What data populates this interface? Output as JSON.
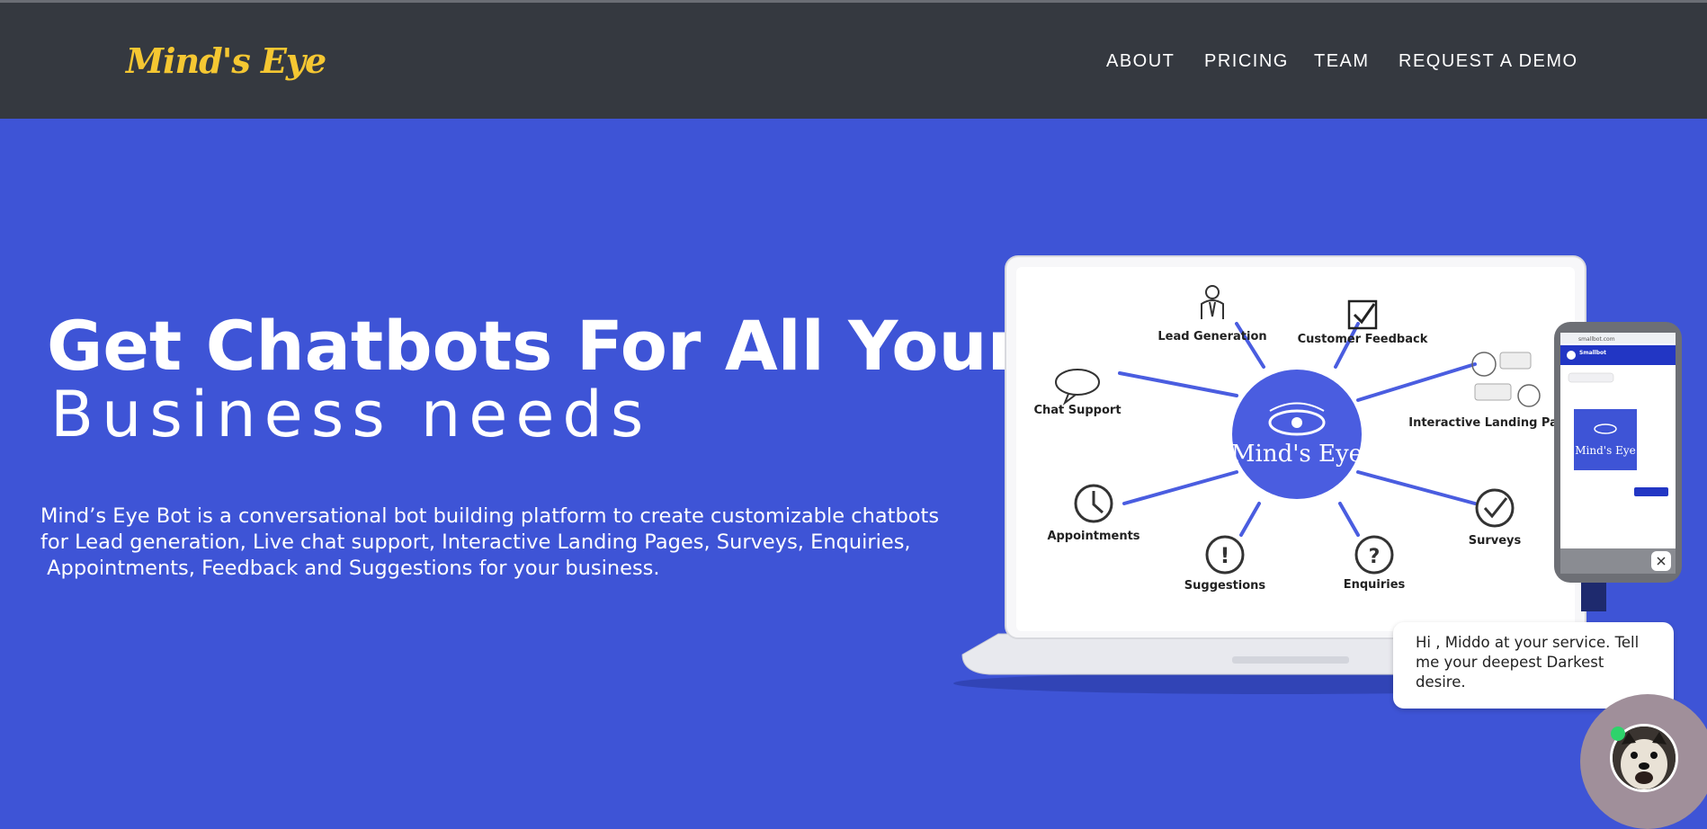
{
  "header": {
    "logo": "Mind's Eye",
    "nav": [
      {
        "label": "ABOUT"
      },
      {
        "label": "PRICING"
      },
      {
        "label": "TEAM"
      },
      {
        "label": "REQUEST A DEMO"
      }
    ]
  },
  "hero": {
    "title_line1": "Get Chatbots For All Your",
    "title_line2": "Business needs",
    "description_lines": [
      "Mind’s Eye Bot is a conversational bot building platform to create customizable chatbots",
      "for Lead generation, Live chat support, Interactive Landing Pages, Surveys, Enquiries,",
      " Appointments, Feedback and Suggestions for your business."
    ]
  },
  "illustration": {
    "center_label": "Mind's Eye",
    "features": [
      "Lead Generation",
      "Customer Feedback",
      "Chat Support",
      "Interactive Landing Pages",
      "Appointments",
      "Surveys",
      "Suggestions",
      "Enquiries"
    ],
    "phone_bot_name": "Smallbot",
    "phone_url": "smallbot.com"
  },
  "chat_widget": {
    "message": "Hi , Middo at your service. Tell me your deepest Darkest desire."
  },
  "colors": {
    "navbar": "#353940",
    "hero_bg": "#3e54d6",
    "logo": "#f5c732",
    "accent": "#4a5de0",
    "online": "#2ed36b"
  }
}
